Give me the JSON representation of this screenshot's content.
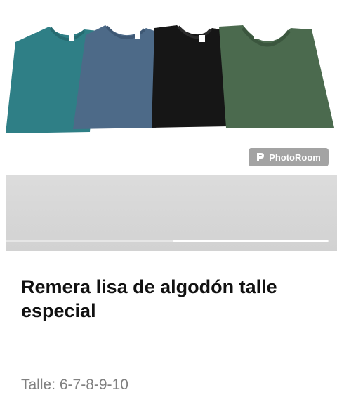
{
  "watermark": {
    "text": "PhotoRoom"
  },
  "product": {
    "title": "Remera lisa de algodón talle especial",
    "size_line": "Talle: 6-7-8-9-10"
  },
  "gallery": {
    "progress_fraction": 0.48
  },
  "colors": {
    "shirt_teal": "#2f7f86",
    "shirt_blue": "#4d6a88",
    "shirt_black": "#161616",
    "shirt_green": "#4b6a4e"
  },
  "icons": [
    "photoroom-logo-icon"
  ]
}
